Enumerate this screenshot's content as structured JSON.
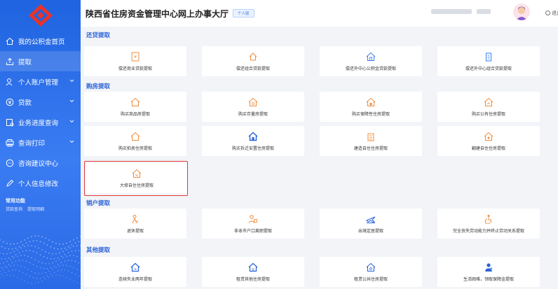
{
  "header": {
    "title": "陕西省住房资金管理中心网上办事大厅",
    "version_badge": "个人版",
    "logout": "退出"
  },
  "colors": {
    "sidebar": "#2a6ae6",
    "accent": "#2a62d8",
    "orange": "#f08c3a",
    "blue": "#3a7cf2",
    "highlight": "#e53935"
  },
  "sidebar": {
    "items": [
      {
        "label": "我的公积金首页",
        "icon": "home-icon"
      },
      {
        "label": "提取",
        "icon": "withdraw-icon"
      },
      {
        "label": "个人账户管理",
        "icon": "user-account-icon"
      },
      {
        "label": "贷款",
        "icon": "loan-icon"
      },
      {
        "label": "业务进度查询",
        "icon": "progress-icon"
      },
      {
        "label": "查询打印",
        "icon": "print-icon"
      },
      {
        "label": "咨询建议中心",
        "icon": "consult-icon"
      },
      {
        "label": "个人信息修改",
        "icon": "edit-info-icon"
      }
    ],
    "common_title": "常用功能",
    "common_links": [
      "贷款查询",
      "提取明细"
    ]
  },
  "sections": [
    {
      "title": "还贷提取",
      "cards": [
        "偿还商业贷款提取",
        "偿还组合贷款提取",
        "偿还外中心公积金贷款提取",
        "偿还外中心组合贷款提取"
      ]
    },
    {
      "title": "购房提取",
      "cards": [
        "购买商品房提取",
        "购买存量房提取",
        "购买保障性住房提取",
        "购买公有住房提取",
        "购买拍卖住房提取",
        "购买拆迁安置住房提取",
        "建造自住住房提取",
        "翻建自住住房提取",
        "大修自住住房提取"
      ]
    },
    {
      "title": "销户提取",
      "cards": [
        "退休提取",
        "非本市户口离职提取",
        "出境定居提取",
        "完全丧失劳动能力并终止劳动关系提取"
      ]
    },
    {
      "title": "其他提取",
      "cards": [
        "连续失业两年提取",
        "租赁其他住房提取",
        "租赁公共住房提取",
        "生活困难，领取保障金提取"
      ]
    }
  ]
}
